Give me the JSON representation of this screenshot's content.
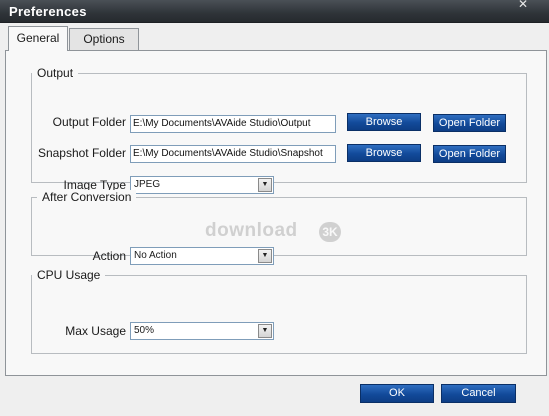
{
  "window": {
    "title": "Preferences",
    "close_glyph": "✕"
  },
  "tabs": [
    {
      "label": "General"
    },
    {
      "label": "Options"
    }
  ],
  "output": {
    "legend": "Output",
    "output_folder_label": "Output Folder",
    "output_folder_value": "E:\\My Documents\\AVAide Studio\\Output",
    "snapshot_folder_label": "Snapshot Folder",
    "snapshot_folder_value": "E:\\My Documents\\AVAide Studio\\Snapshot",
    "browse_label": "Browse",
    "open_folder_label": "Open Folder",
    "image_type_label": "Image Type",
    "image_type_value": "JPEG"
  },
  "after_conversion": {
    "legend": "After Conversion",
    "action_label": "Action",
    "action_value": "No Action"
  },
  "cpu_usage": {
    "legend": "CPU Usage",
    "max_usage_label": "Max Usage",
    "max_usage_value": "50%"
  },
  "watermark": {
    "text": "download",
    "badge": "3K"
  },
  "footer": {
    "ok_label": "OK",
    "cancel_label": "Cancel"
  },
  "colors": {
    "titlebar": "#2f3439",
    "button_blue": "#124a9a",
    "panel_bg": "#f8f8f8"
  }
}
